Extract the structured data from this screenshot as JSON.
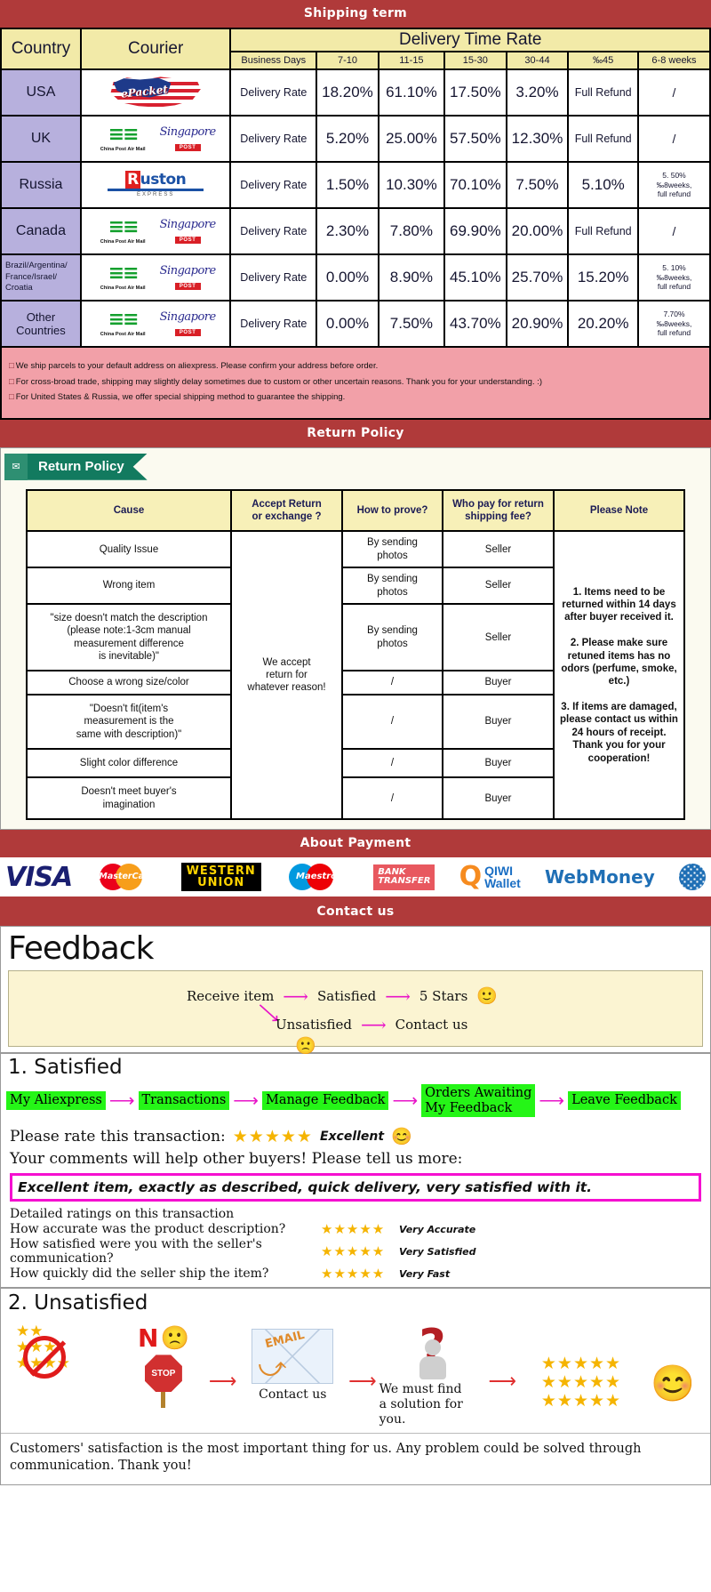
{
  "banners": {
    "shipping": "Shipping term",
    "return": "Return Policy",
    "payment": "About Payment",
    "contact": "Contact us"
  },
  "shipping": {
    "headers": {
      "country": "Country",
      "courier": "Courier",
      "delivery_time_rate": "Delivery Time Rate",
      "business_days": "Business Days",
      "ranges": [
        "7-10",
        "11-15",
        "15-30",
        "30-44",
        "‰45",
        "6-8 weeks"
      ]
    },
    "rate_label": "Delivery Rate",
    "rows": [
      {
        "country": "USA",
        "couriers": [
          "epacket"
        ],
        "values": [
          "18.20%",
          "61.10%",
          "17.50%",
          "3.20%"
        ],
        "over45": "Full Refund",
        "weeks": "/"
      },
      {
        "country": "UK",
        "couriers": [
          "china-post-air-mail",
          "singapore-post"
        ],
        "values": [
          "5.20%",
          "25.00%",
          "57.50%",
          "12.30%"
        ],
        "over45": "Full Refund",
        "weeks": "/"
      },
      {
        "country": "Russia",
        "couriers": [
          "ruston-express"
        ],
        "values": [
          "1.50%",
          "10.30%",
          "70.10%",
          "7.50%"
        ],
        "over45": "5.10%",
        "weeks": "5. 50%\n‰8weeks,\nfull refund"
      },
      {
        "country": "Canada",
        "couriers": [
          "china-post-air-mail",
          "singapore-post"
        ],
        "values": [
          "2.30%",
          "7.80%",
          "69.90%",
          "20.00%"
        ],
        "over45": "Full Refund",
        "weeks": "/"
      },
      {
        "country": "Brazil/Argentina/\nFrance/Israel/\nCroatia",
        "couriers": [
          "china-post-air-mail",
          "singapore-post"
        ],
        "values": [
          "0.00%",
          "8.90%",
          "45.10%",
          "25.70%"
        ],
        "over45": "15.20%",
        "weeks": "5. 10%\n‰8weeks,\nfull refund"
      },
      {
        "country": "Other Countries",
        "couriers": [
          "china-post-air-mail",
          "singapore-post"
        ],
        "values": [
          "0.00%",
          "7.50%",
          "43.70%",
          "20.90%"
        ],
        "over45": "20.20%",
        "weeks": "7.70%\n‰8weeks,\nfull refund"
      }
    ],
    "logos": {
      "epacket_word": "ePacket",
      "china_post_caption": "China Post Air Mail",
      "singapore_word": "Singapore",
      "singapore_badge": "POST",
      "ruston_k": "R",
      "ruston_rest": "uston",
      "ruston_sub": "EXPRESS"
    },
    "notes": [
      "We ship parcels to your default address on aliexpress. Please confirm your address before order.",
      "For cross-broad trade, shipping may slightly delay sometimes due to custom or other uncertain reasons. Thank you for your understanding. :)",
      "For United States & Russia, we offer special shipping method to guarantee the shipping."
    ]
  },
  "return_policy": {
    "ribbon_label": "Return Policy",
    "ribbon_icon": "mail-icon",
    "headers": [
      "Cause",
      "Accept Return\nor exchange ?",
      "How to prove?",
      "Who pay for return\nshipping fee?",
      "Please Note"
    ],
    "accept_text": "We accept\nreturn for\nwhatever reason!",
    "note_text": "1. Items need to be returned within 14 days after buyer received it.\n\n2. Please make sure retuned items has no odors (perfume, smoke, etc.)\n\n3. If items are damaged, please contact us within 24 hours of receipt.\nThank you for your cooperation!",
    "rows": [
      {
        "cause": "Quality Issue",
        "prove": "By sending\nphotos",
        "payer": "Seller"
      },
      {
        "cause": "Wrong item",
        "prove": "By sending\nphotos",
        "payer": "Seller"
      },
      {
        "cause": "\"size doesn't match the description\n(please note:1-3cm manual\nmeasurement difference\nis inevitable)\"",
        "prove": "By sending\nphotos",
        "payer": "Seller"
      },
      {
        "cause": "Choose a wrong size/color",
        "prove": "/",
        "payer": "Buyer"
      },
      {
        "cause": "\"Doesn't fit(item's\nmeasurement is the\nsame with description)\"",
        "prove": "/",
        "payer": "Buyer"
      },
      {
        "cause": "Slight color difference",
        "prove": "/",
        "payer": "Buyer"
      },
      {
        "cause": "Doesn't meet buyer's\nimagination",
        "prove": "/",
        "payer": "Buyer"
      }
    ]
  },
  "payment": {
    "methods": [
      {
        "name": "visa",
        "label": "VISA"
      },
      {
        "name": "mastercard",
        "label": "MasterCard"
      },
      {
        "name": "western-union",
        "label_top": "WESTERN",
        "label_bottom": "UNION"
      },
      {
        "name": "maestro",
        "label": "Maestro"
      },
      {
        "name": "bank-transfer",
        "label_top": "BANK",
        "label_bottom": "TRANSFER"
      },
      {
        "name": "qiwi-wallet",
        "label_top": "QIWI",
        "label_bottom": "Wallet"
      },
      {
        "name": "webmoney",
        "label": "WebMoney"
      }
    ]
  },
  "feedback": {
    "title": "Feedback",
    "flow": {
      "receive": "Receive item",
      "satisfied": "Satisfied",
      "five_stars": "5 Stars",
      "unsatisfied": "Unsatisfied",
      "contact": "Contact us",
      "smiley": "🙂",
      "frowny": "🙁"
    },
    "satisfied": {
      "heading": "1. Satisfied",
      "steps": [
        "My Aliexpress",
        "Transactions",
        "Manage Feedback",
        "Orders Awaiting\nMy Feedback",
        "Leave Feedback"
      ],
      "rate_prompt": "Please rate this transaction:",
      "rate_stars": "★★★★★",
      "rate_word": "Excellent",
      "rate_emoji": "😊",
      "comment_prompt": "Your comments will help other buyers! Please tell us more:",
      "comment_text": "Excellent item, exactly as described, quick delivery, very satisfied with it.",
      "detail_heading": "Detailed ratings on this transaction",
      "details": [
        {
          "question": "How accurate was the product description?",
          "stars": "★★★★★",
          "value": "Very Accurate"
        },
        {
          "question": "How satisfied were you with the seller's communication?",
          "stars": "★★★★★",
          "value": "Very Satisfied"
        },
        {
          "question": "How quickly did the seller ship the item?",
          "stars": "★★★★★",
          "value": "Very Fast"
        }
      ]
    },
    "unsatisfied": {
      "heading": "2. Unsatisfied",
      "no_word": "N",
      "stop_word": "STOP",
      "email_word": "EMAIL",
      "contact_caption": "Contact us",
      "solution_caption": "We must find\na solution for\nyou.",
      "question_mark": "?",
      "good_stars_rows": [
        "★★★★★",
        "★★★★★",
        "★★★★★"
      ],
      "bad_star_rows": [
        "★★",
        "★★★",
        "★★★★"
      ],
      "happy_emoji": "😊",
      "sad_emoji": "🙁",
      "arrow": "⟶",
      "footer": "Customers' satisfaction is the most important thing for us. Any problem could be solved through communication. Thank you!"
    }
  },
  "colors": {
    "banner_red": "#b03a3a",
    "header_yellow": "#f2eaa8",
    "country_purple": "#b7b0dd",
    "note_pink": "#f2a0a8",
    "green_step": "#25f517",
    "magenta": "#f50fd0",
    "ribbon_green": "#127a5f"
  }
}
